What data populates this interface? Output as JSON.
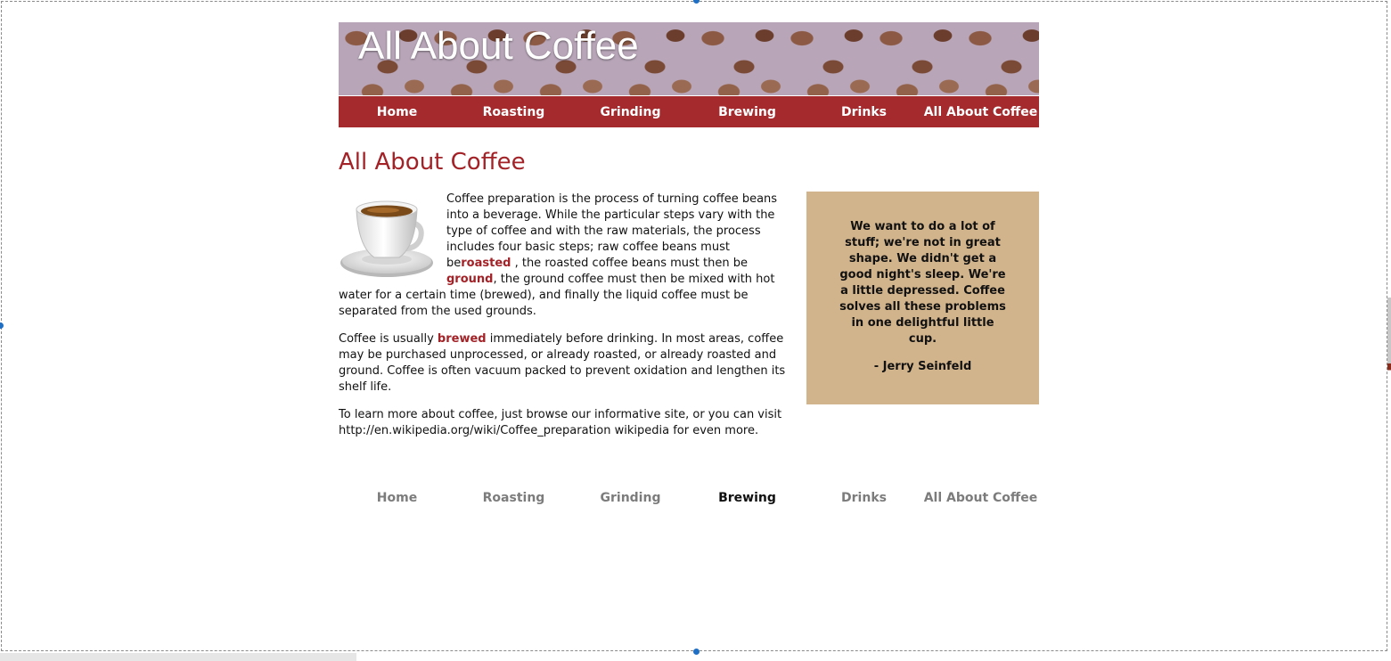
{
  "header": {
    "title": "All About Coffee"
  },
  "nav_top": [
    "Home",
    "Roasting",
    "Grinding",
    "Brewing",
    "Drinks",
    "All About Coffee"
  ],
  "main": {
    "heading": "All About Coffee",
    "p1": {
      "t1": "Coffee preparation is the process of turning coffee beans into a beverage. While the particular steps vary with the type of coffee and with the raw materials, the process includes four basic steps; raw coffee beans must be",
      "roasted": "roasted",
      "t2": " , the roasted coffee beans must then be ",
      "ground": "ground",
      "t3": ", the ground coffee must then be mixed with hot water for a certain time (brewed), and finally the liquid coffee must be separated from the used grounds."
    },
    "p2": {
      "t1": "Coffee is usually ",
      "brewed": "brewed",
      "t2": " immediately before drinking. In most areas, coffee may be purchased unprocessed, or already roasted, or already roasted and ground. Coffee is often vacuum packed to prevent oxidation and lengthen its shelf life."
    },
    "p3": "To learn more about coffee, just browse our informative site, or you can visit http://en.wikipedia.org/wiki/Coffee_preparation wikipedia for even more."
  },
  "quote": {
    "text": "We want to do a lot of stuff; we're not in great shape. We didn't get a good night's sleep. We're a little depressed. Coffee solves all these problems in one delightful little cup.",
    "author": "- Jerry Seinfeld"
  },
  "nav_bottom": {
    "items": [
      "Home",
      "Roasting",
      "Grinding",
      "Brewing",
      "Drinks",
      "All About Coffee"
    ],
    "active": "Brewing"
  },
  "colors": {
    "accent": "#a32227",
    "nav_bar": "#a52a2e",
    "quote_bg": "#d2b48c",
    "inactive_link": "#7c7c7c"
  },
  "icons": {
    "cup": "coffee-cup-image"
  }
}
